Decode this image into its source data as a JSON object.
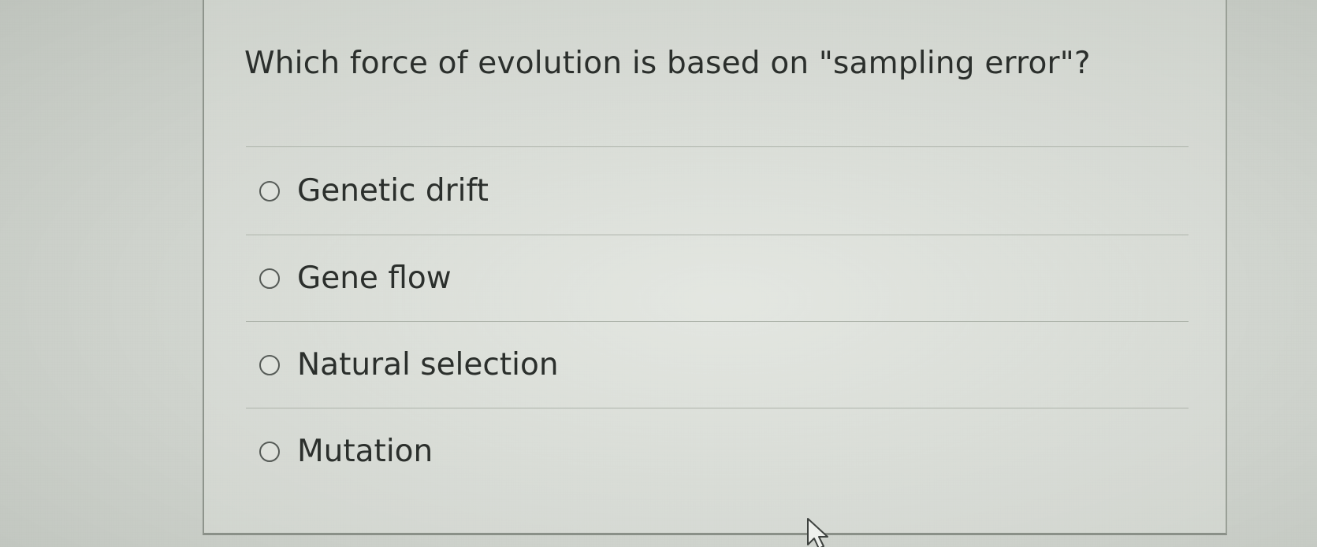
{
  "question": {
    "text": "Which force of evolution is based on \"sampling error\"?"
  },
  "options": [
    {
      "label": "Genetic drift",
      "selected": false
    },
    {
      "label": "Gene flow",
      "selected": false
    },
    {
      "label": "Natural selection",
      "selected": false
    },
    {
      "label": "Mutation",
      "selected": false
    }
  ],
  "colors": {
    "text": "#2b2f2c",
    "divider": "#aeb4ab",
    "radio_border": "#565b57"
  },
  "icons": {
    "radio": "radio-button-icon",
    "cursor": "mouse-pointer-icon"
  }
}
